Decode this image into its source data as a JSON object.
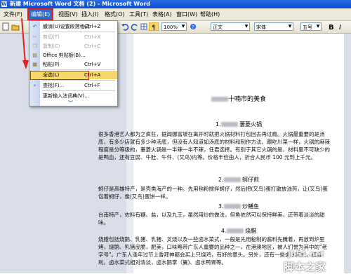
{
  "window": {
    "title": "新建 Microsoft Word 文档 (2) - Microsoft Word",
    "app_icon": "W"
  },
  "menubar": {
    "items": [
      "文件(F)",
      "编辑(E)",
      "视图(V)",
      "插入(I)",
      "格式(O)",
      "工具(T)",
      "表格(A)",
      "窗口(W)",
      "帮助(H)"
    ],
    "active": "编辑(E)"
  },
  "toolbar": {
    "zoom": "100%",
    "style": "正文",
    "font": "宋体",
    "size": "五号"
  },
  "edit_menu": {
    "items": [
      {
        "label": "撤消(U)设置段落格式",
        "shortcut": "Ctrl+Z",
        "icon": "undo-icon",
        "disabled": false
      },
      {
        "label": "剪切(T)",
        "shortcut": "Ctrl+X",
        "icon": "cut-icon",
        "disabled": true
      },
      {
        "label": "复制(C)",
        "shortcut": "Ctrl+C",
        "icon": "copy-icon",
        "disabled": true
      },
      {
        "label": "Office 剪贴板(B)...",
        "shortcut": "",
        "icon": "clipboard-icon",
        "disabled": false
      },
      {
        "label": "粘贴(P)",
        "shortcut": "Ctrl+V",
        "icon": "paste-icon",
        "disabled": false
      },
      {
        "label": "全选(L)",
        "shortcut": "Ctrl+A",
        "icon": "",
        "disabled": false,
        "highlighted": true
      },
      {
        "label": "查找(F)...",
        "shortcut": "Ctrl+F",
        "icon": "find-icon",
        "disabled": false
      },
      {
        "label": "更新输入法词典(V)...",
        "shortcut": "",
        "icon": "",
        "disabled": false
      }
    ],
    "expand_glyph": "︾"
  },
  "document": {
    "title_suffix": "十喃市的美食",
    "sections": [
      {
        "heading_num": "1.",
        "heading_name": "萋菱火锅",
        "body": [
          "很多香港艺人都为之疯狂，据闻娜富坡在离开时就把火锅材料打包回去再过瘾。火锅最重要的是汤底，有多少店就有多少种汤底，但没有人知道如汤底的材料和制作方法。跟吃川菜一样，火锅的麻辣程度是分等级的，萋菱火锅是一半辣一半不辣，任君选择。有别于其它火锅的是，材料里不可缺少的是鸭血，还有豆腐、牛肚、牛件、(又鸟)内等。价格丰俭由人，折合人民币 100 元到上千元。"
        ]
      },
      {
        "heading_num": "2.",
        "heading_name": "蚵仔煎",
        "body": [
          "蚵仔是高雄特产，是壳类海产的一种。先用毡粉搅拌蚵仔，然后把(又鸟)蛋打散放油煎，让(又鸟)蛋包着蚵仔，像(又鸟)蛋饼一样。"
        ]
      },
      {
        "heading_num": "3.",
        "heading_name": "炒鳝鱼",
        "body": [
          "台南特产，佐料有糖、盐，以及九王，虽然用炒的做法，但鱼依然可以保持鲜美，还带着淡淡的甜味。"
        ]
      },
      {
        "heading_num": "4.",
        "heading_name": "烧腊",
        "body": [
          "烧腊包括烧鹅、乳猪、乳猪、叉烧以及一些卤水菜式，一般是先用秘制的酱料先腌着，再放到炉里烤，烧鹅、乳猪皮脆，肥美，口味略带广东人重要的品种之一，在港澳地区，被人们誉为其中的\"老字号\"。广东人逢年过节上香拜神都会买上只烧鸡，有好的意头。另外，还有一些卤水菜式，图吉利。卤水菜式相对清淡，卤水鹅掌（翼)、卤水鸭肾等。"
        ]
      }
    ]
  },
  "watermark": {
    "site": "jb51.net",
    "brand": "脚本之家"
  }
}
